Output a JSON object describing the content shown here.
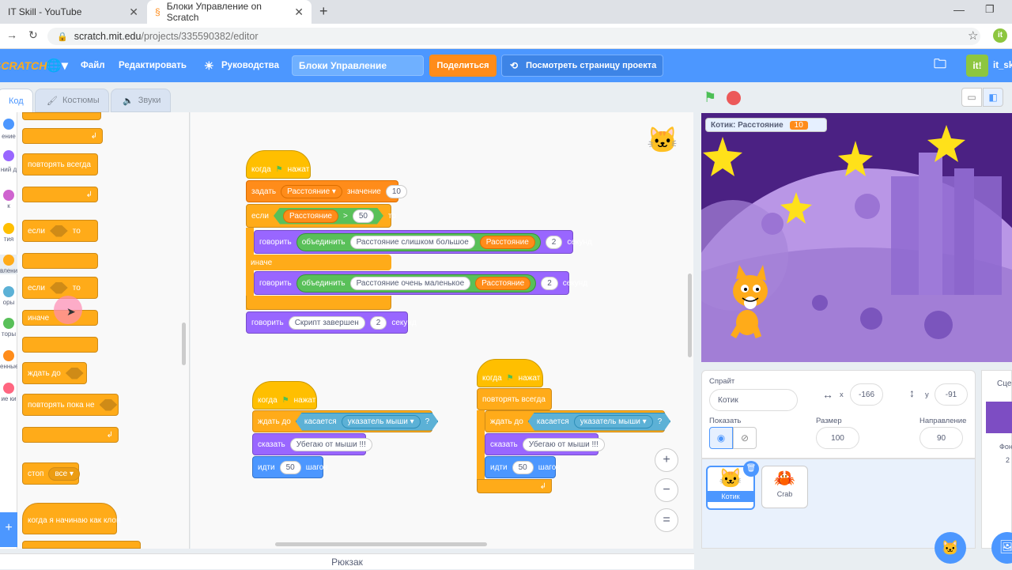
{
  "browser": {
    "tabs": [
      {
        "title": "IT Skill - YouTube",
        "close": "✕"
      },
      {
        "title": "Блоки Управление on Scratch",
        "close": "✕"
      }
    ],
    "new_tab": "+",
    "url_host": "scratch.mit.edu",
    "url_path": "/projects/335590382/editor",
    "profile_label": "it_sk"
  },
  "menubar": {
    "logo": "SCRATCH",
    "file": "Файл",
    "edit": "Редактировать",
    "tutorials": "Руководства",
    "project_title": "Блоки Управление",
    "share": "Поделиться",
    "see_project": "Посмотреть страницу проекта"
  },
  "editor_tabs": {
    "code": "Код",
    "costumes": "Костюмы",
    "sounds": "Звуки"
  },
  "categories": [
    {
      "label": "",
      "color": "#4c97ff"
    },
    {
      "label": "ение",
      "color": "#4c97ff"
    },
    {
      "label": "ний\nд",
      "color": "#9966ff"
    },
    {
      "label": "к",
      "color": "#cf63cf"
    },
    {
      "label": "тия",
      "color": "#ffbf00"
    },
    {
      "label": "вление",
      "color": "#ffab19"
    },
    {
      "label": "оры",
      "color": "#5cb1d6"
    },
    {
      "label": "торы",
      "color": "#59c059"
    },
    {
      "label": "енные",
      "color": "#ff8c1a"
    },
    {
      "label": "ие\nки",
      "color": "#ff6680"
    }
  ],
  "palette": {
    "repeat_forever": "повторять всегда",
    "if": "если",
    "then": "то",
    "if2": "если",
    "then2": "то",
    "else": "иначе",
    "wait_until": "ждать до",
    "repeat_until": "повторять пока не",
    "stop": "стоп",
    "stop_opt": "все",
    "clone_start": "когда я начинаю как клон"
  },
  "script1": {
    "hat": "когда",
    "hat2": "нажат",
    "set": "задать",
    "var": "Расстояние",
    "value_word": "значение",
    "value": "10",
    "if": "если",
    "cond_var": "Расстояние",
    "op": ">",
    "cond_val": "50",
    "then": "то",
    "say1": "говорить",
    "join1": "объединить",
    "text1": "Расстояние  слишком большое",
    "var1": "Расстояние",
    "secs1": "2",
    "sec_word1": "секунд",
    "else": "иначе",
    "say2": "говорить",
    "join2": "объединить",
    "text2": "Расстояние  очень маленькое",
    "var2": "Расстояние",
    "secs2": "2",
    "sec_word2": "секунд",
    "say3": "говорить",
    "text3": "Скрипт завершен",
    "secs3": "2",
    "sec_word3": "секунд"
  },
  "script2": {
    "hat": "когда",
    "hat2": "нажат",
    "wait": "ждать до",
    "touching": "касается",
    "target": "указатель мыши",
    "q": "?",
    "say": "сказать",
    "text": "Убегаю от мыши !!!",
    "move": "идти",
    "steps": "50",
    "steps_word": "шагов"
  },
  "script3": {
    "hat": "когда",
    "hat2": "нажат",
    "forever": "повторять всегда",
    "wait": "ждать до",
    "touching": "касается",
    "target": "указатель мыши",
    "q": "?",
    "say": "сказать",
    "text": "Убегаю от мыши !!!",
    "move": "идти",
    "steps": "50",
    "steps_word": "шагов"
  },
  "zoom": {
    "in": "+",
    "out": "−",
    "reset": "="
  },
  "stage": {
    "monitor_label": "Котик: Расстояние",
    "monitor_value": "10"
  },
  "sprite_info": {
    "sprite_label": "Спрайт",
    "sprite_name": "Котик",
    "x_label": "x",
    "x_value": "-166",
    "y_label": "y",
    "y_value": "-91",
    "show_label": "Показать",
    "size_label": "Размер",
    "size_value": "100",
    "direction_label": "Направление",
    "direction_value": "90"
  },
  "sprites": [
    {
      "name": "Котик",
      "selected": true
    },
    {
      "name": "Crab",
      "selected": false
    }
  ],
  "stage_panel": {
    "title": "Сцен",
    "bg_label": "Фон",
    "bg_count": "2"
  },
  "backpack": "Рюкзак"
}
